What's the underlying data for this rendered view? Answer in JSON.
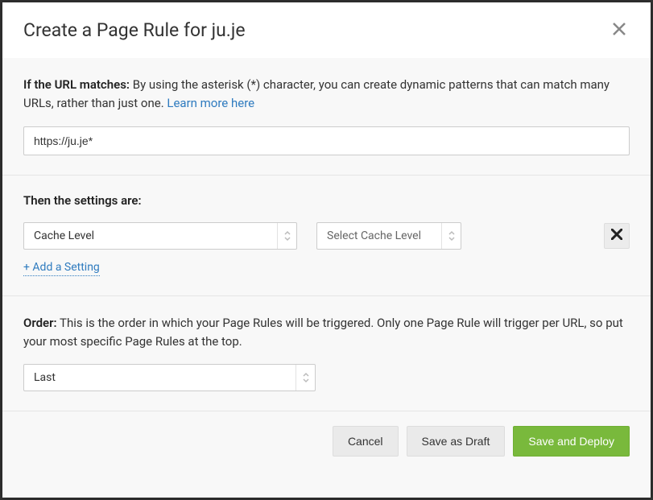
{
  "header": {
    "title": "Create a Page Rule for ju.je"
  },
  "url_section": {
    "label": "If the URL matches:",
    "description": "By using the asterisk (*) character, you can create dynamic patterns that can match many URLs, rather than just one. ",
    "learn_more": "Learn more here",
    "input_value": "https://ju.je*"
  },
  "settings_section": {
    "heading": "Then the settings are:",
    "setting_select": "Cache Level",
    "value_select": "Select Cache Level",
    "add_setting": "+ Add a Setting"
  },
  "order_section": {
    "label": "Order:",
    "description": "This is the order in which your Page Rules will be triggered. Only one Page Rule will trigger per URL, so put your most specific Page Rules at the top.",
    "select_value": "Last"
  },
  "footer": {
    "cancel": "Cancel",
    "save_draft": "Save as Draft",
    "save_deploy": "Save and Deploy"
  }
}
